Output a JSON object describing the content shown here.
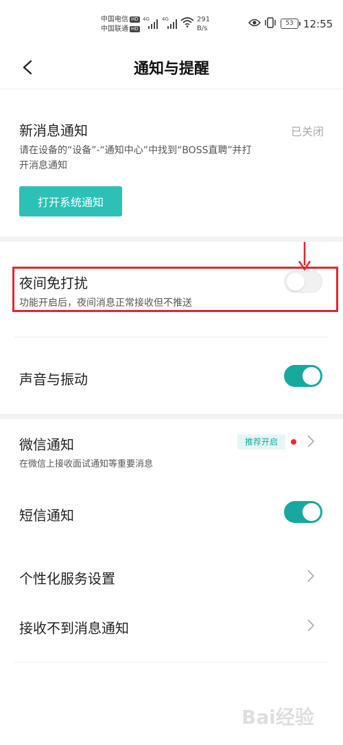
{
  "status_bar": {
    "carrier1": "中国电信",
    "carrier2": "中国联通",
    "hd_badge": "HD",
    "network1": "4G",
    "network2": "4G",
    "speed_value": "291",
    "speed_unit": "B/s",
    "battery": "53",
    "time": "12:55"
  },
  "header": {
    "title": "通知与提醒",
    "back_icon": "chevron-left-icon"
  },
  "new_message": {
    "title": "新消息通知",
    "status": "已关闭",
    "desc": "请在设备的“设备”-“通知中心”中找到“BOSS直聘”并打开消息通知",
    "button": "打开系统通知"
  },
  "night_mode": {
    "title": "夜间免打扰",
    "desc": "功能开启后，夜间消息正常接收但不推送",
    "enabled": false
  },
  "sound_vibration": {
    "title": "声音与振动",
    "enabled": true
  },
  "wechat": {
    "title": "微信通知",
    "desc": "在微信上接收面试通知等重要消息",
    "badge": "推荐开启"
  },
  "sms": {
    "title": "短信通知",
    "enabled": true
  },
  "personalized": {
    "title": "个性化服务设置"
  },
  "not_receiving": {
    "title": "接收不到消息通知"
  },
  "colors": {
    "accent": "#2cc0b6",
    "toggle_on": "#17a99e",
    "highlight": "#e8232a"
  },
  "watermark": "Bai经验"
}
